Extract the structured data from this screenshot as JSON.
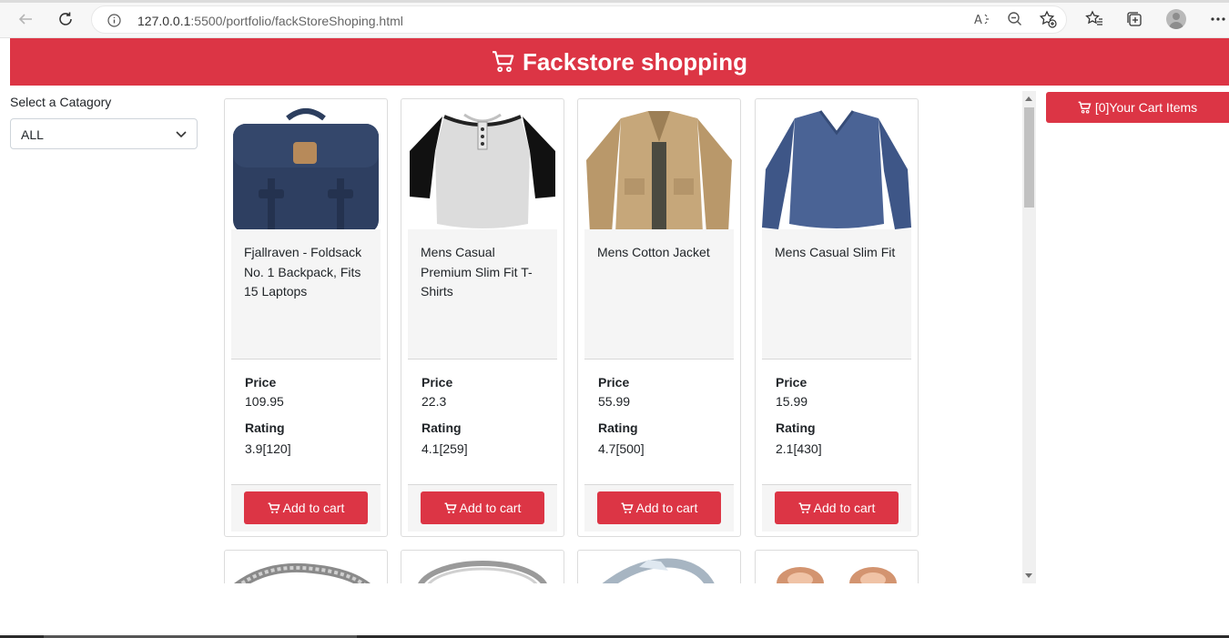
{
  "browser": {
    "url_host": "127.0.0.1",
    "url_rest": ":5500/portfolio/fackStoreShoping.html"
  },
  "header": {
    "title": "Fackstore shopping"
  },
  "sidebar": {
    "label": "Select a Catagory",
    "selected": "ALL"
  },
  "cart_button": {
    "label": "[0]Your Cart Items"
  },
  "labels": {
    "price": "Price",
    "rating": "Rating",
    "add_to_cart": "Add to cart"
  },
  "products": [
    {
      "name": "Fjallraven - Foldsack No. 1 Backpack, Fits 15 Laptops",
      "price": "109.95",
      "rating": "3.9[120]",
      "image": "backpack"
    },
    {
      "name": "Mens Casual Premium Slim Fit T-Shirts",
      "price": "22.3",
      "rating": "4.1[259]",
      "image": "raglan-tshirt"
    },
    {
      "name": "Mens Cotton Jacket",
      "price": "55.99",
      "rating": "4.7[500]",
      "image": "jacket"
    },
    {
      "name": "Mens Casual Slim Fit",
      "price": "15.99",
      "rating": "2.1[430]",
      "image": "long-sleeve-shirt"
    }
  ],
  "colors": {
    "accent": "#dc3545"
  }
}
